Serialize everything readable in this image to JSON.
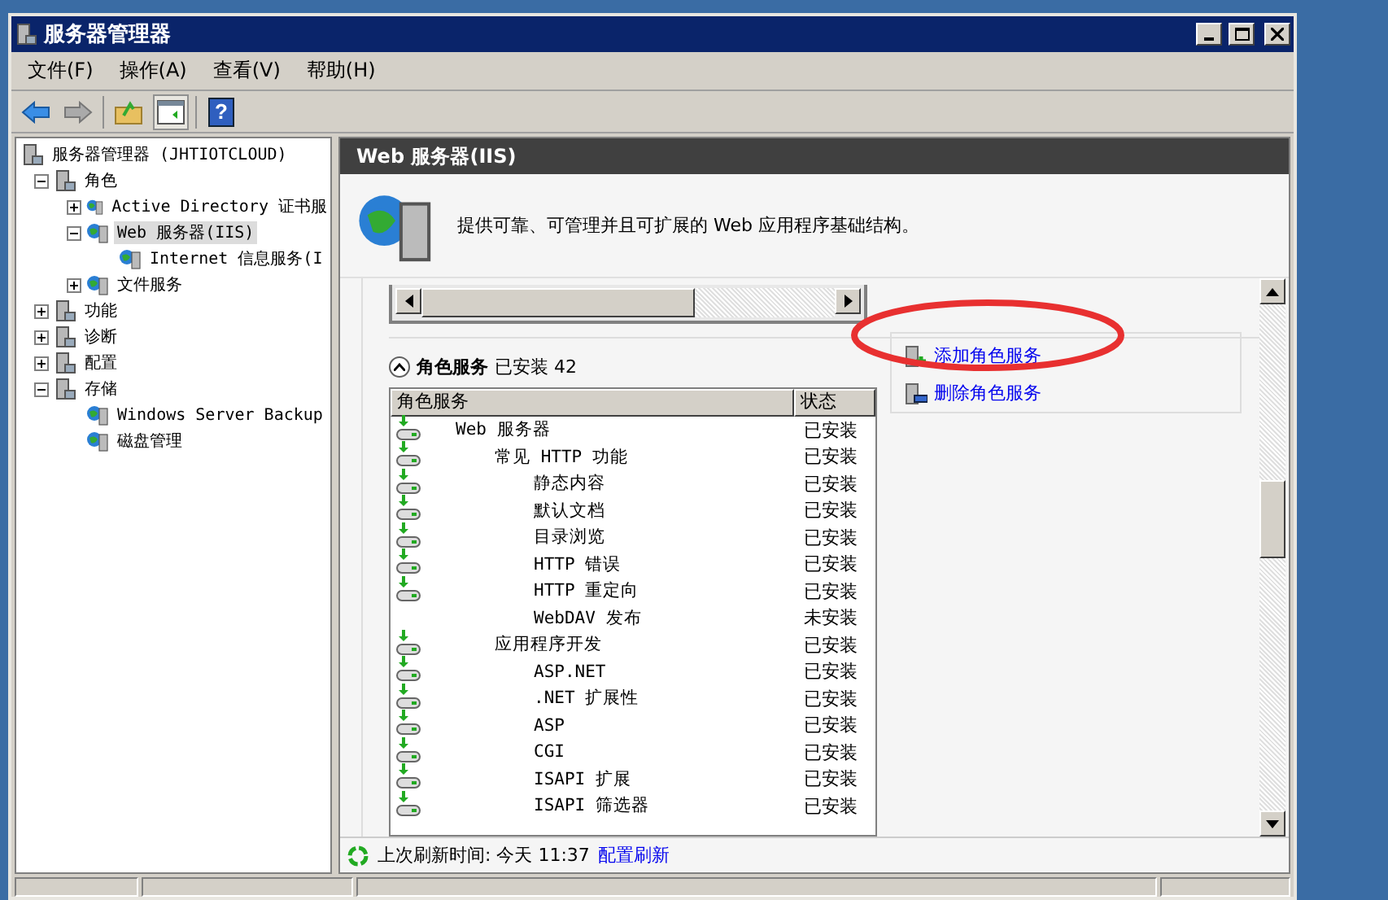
{
  "window": {
    "title": "服务器管理器"
  },
  "menu": [
    "文件(F)",
    "操作(A)",
    "查看(V)",
    "帮助(H)"
  ],
  "toolbar": {
    "help_glyph": "?"
  },
  "tree": {
    "label": "服务器管理器 (JHTIOTCLOUD)",
    "items": [
      {
        "label": "角色",
        "expanded": true,
        "selected": false,
        "children": [
          {
            "label": "Active Directory 证书服",
            "expanded": false,
            "selected": false
          },
          {
            "label": "Web 服务器(IIS)",
            "expanded": true,
            "selected": true,
            "children": [
              {
                "label": "Internet 信息服务(I",
                "selected": false
              }
            ]
          },
          {
            "label": "文件服务",
            "expanded": false,
            "selected": false
          }
        ]
      },
      {
        "label": "功能",
        "expanded": false,
        "selected": false
      },
      {
        "label": "诊断",
        "expanded": false,
        "selected": false
      },
      {
        "label": "配置",
        "expanded": false,
        "selected": false
      },
      {
        "label": "存储",
        "expanded": true,
        "selected": false,
        "children": [
          {
            "label": "Windows Server Backup",
            "selected": false
          },
          {
            "label": "磁盘管理",
            "selected": false
          }
        ]
      }
    ]
  },
  "panel": {
    "title": "Web 服务器(IIS)",
    "description": "提供可靠、可管理并且可扩展的 Web 应用程序基础结构。"
  },
  "role_services": {
    "heading": "角色服务",
    "summary": "已安装 42",
    "expanded": true,
    "columns": [
      "角色服务",
      "状态"
    ],
    "rows": [
      {
        "name": "Web 服务器",
        "status": "已安装",
        "installed": true,
        "children": [
          {
            "name": "常见 HTTP 功能",
            "status": "已安装",
            "installed": true,
            "children": [
              {
                "name": "静态内容",
                "status": "已安装",
                "installed": true
              },
              {
                "name": "默认文档",
                "status": "已安装",
                "installed": true
              },
              {
                "name": "目录浏览",
                "status": "已安装",
                "installed": true
              },
              {
                "name": "HTTP 错误",
                "status": "已安装",
                "installed": true
              },
              {
                "name": "HTTP 重定向",
                "status": "已安装",
                "installed": true
              },
              {
                "name": "WebDAV 发布",
                "status": "未安装",
                "installed": false
              }
            ]
          },
          {
            "name": "应用程序开发",
            "status": "已安装",
            "installed": true,
            "children": [
              {
                "name": "ASP.NET",
                "status": "已安装",
                "installed": true
              },
              {
                "name": ".NET 扩展性",
                "status": "已安装",
                "installed": true
              },
              {
                "name": "ASP",
                "status": "已安装",
                "installed": true
              },
              {
                "name": "CGI",
                "status": "已安装",
                "installed": true
              },
              {
                "name": "ISAPI 扩展",
                "status": "已安装",
                "installed": true
              },
              {
                "name": "ISAPI 筛选器",
                "status": "已安装",
                "installed": true
              }
            ]
          }
        ]
      }
    ],
    "actions": [
      {
        "kind": "add",
        "label": "添加角色服务"
      },
      {
        "kind": "remove",
        "label": "删除角色服务"
      }
    ]
  },
  "refresh": {
    "label": "上次刷新时间: 今天 11:37",
    "link": "配置刷新"
  }
}
